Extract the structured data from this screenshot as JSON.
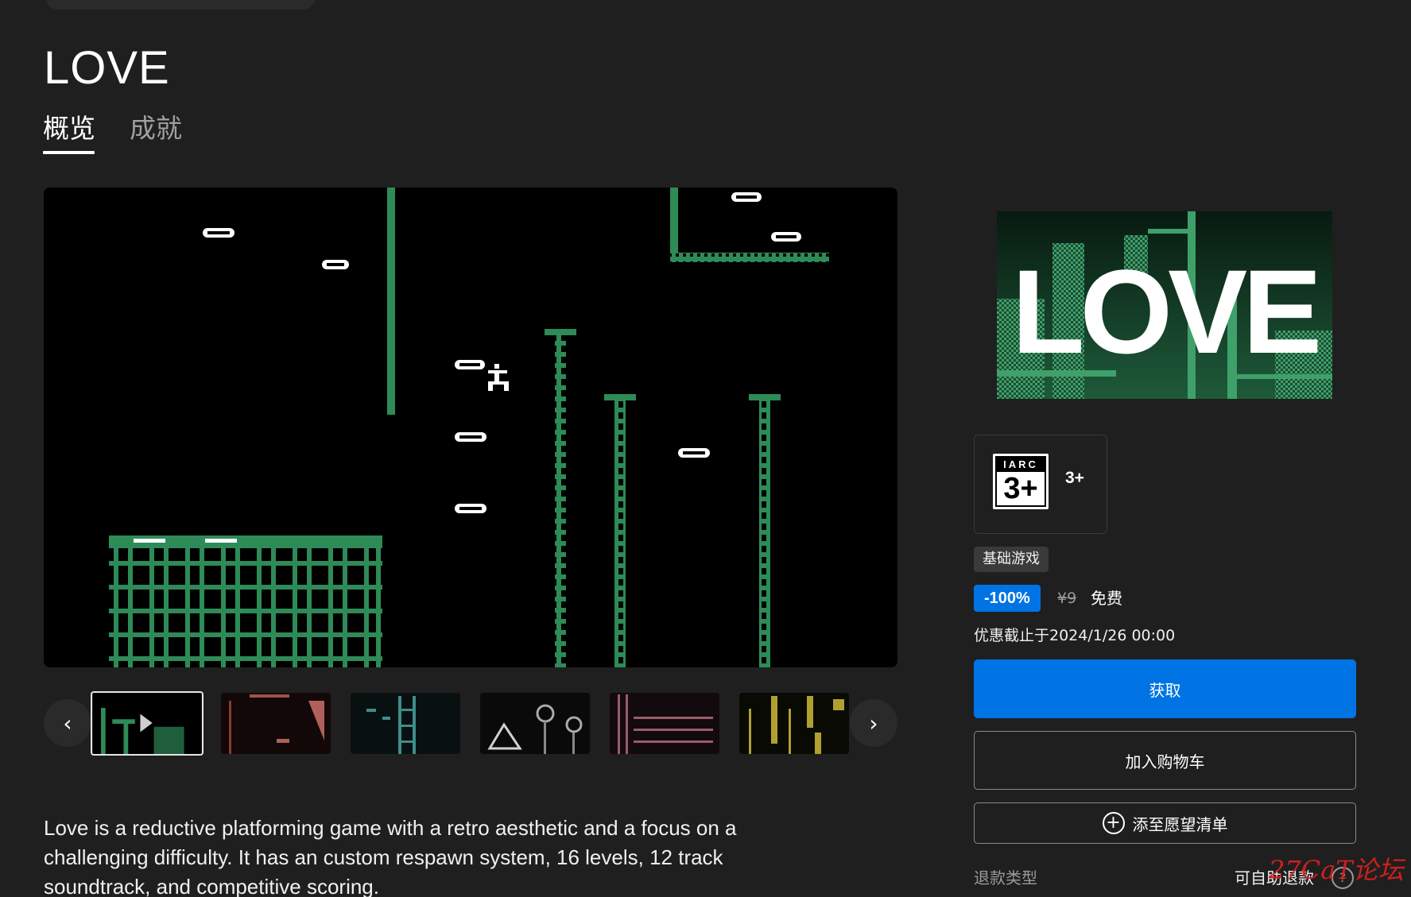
{
  "game": {
    "title": "LOVE"
  },
  "tabs": [
    {
      "label": "概览",
      "active": true
    },
    {
      "label": "成就",
      "active": false
    }
  ],
  "carousel": {
    "prev_icon": "chevron-left-icon",
    "next_icon": "chevron-right-icon",
    "thumbnail_count": 6
  },
  "description": "Love is a reductive platforming game with a retro aesthetic and a focus on a challenging difficulty. It has an custom respawn system, 16 levels, 12 track soundtrack, and competitive scoring.",
  "rating": {
    "board": "IARC",
    "age": "3+",
    "label": "3+"
  },
  "tag": "基础游戏",
  "price": {
    "discount": "-100%",
    "original": "¥9",
    "final": "免费"
  },
  "promo_end": "优惠截止于2024/1/26 00:00",
  "buttons": {
    "get": "获取",
    "cart": "加入购物车",
    "wishlist": "添至愿望清单"
  },
  "refund": {
    "label": "退款类型",
    "value": "可自助退款"
  },
  "watermark": "27CaT论坛",
  "colors": {
    "accent": "#0074e4",
    "background": "#1f1f1f",
    "game_green": "#2e8b57"
  }
}
